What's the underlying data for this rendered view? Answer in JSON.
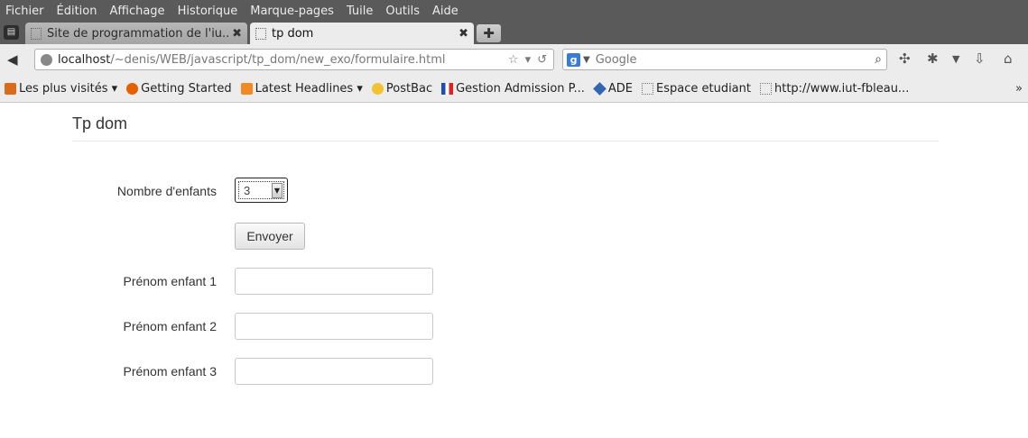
{
  "menubar": {
    "items": [
      "Fichier",
      "Édition",
      "Affichage",
      "Historique",
      "Marque-pages",
      "Tuile",
      "Outils",
      "Aide"
    ]
  },
  "tabs": [
    {
      "label": "Site de programmation de l'iu..."
    },
    {
      "label": "tp dom"
    }
  ],
  "navbar": {
    "url_host": "localhost",
    "url_path": "/~denis/WEB/javascript/tp_dom/new_exo/formulaire.html",
    "search_placeholder": "Google"
  },
  "bookmarks": [
    {
      "label": "Les plus visités ▾",
      "icon": "folder-icon"
    },
    {
      "label": "Getting Started",
      "icon": "firefox-icon"
    },
    {
      "label": "Latest Headlines ▾",
      "icon": "rss-icon"
    },
    {
      "label": "PostBac",
      "icon": "medal-icon"
    },
    {
      "label": "Gestion Admission P...",
      "icon": "flag-icon"
    },
    {
      "label": "ADE",
      "icon": "ade-icon"
    },
    {
      "label": "Espace etudiant",
      "icon": "blank-page-icon"
    },
    {
      "label": "http://www.iut-fbleau...",
      "icon": "blank-page-icon"
    }
  ],
  "page": {
    "title": "Tp dom",
    "children_label": "Nombre d'enfants",
    "children_selected": "3",
    "send_label": "Envoyer",
    "fields": [
      {
        "label": "Prénom enfant 1",
        "value": ""
      },
      {
        "label": "Prénom enfant 2",
        "value": ""
      },
      {
        "label": "Prénom enfant 3",
        "value": ""
      }
    ]
  }
}
